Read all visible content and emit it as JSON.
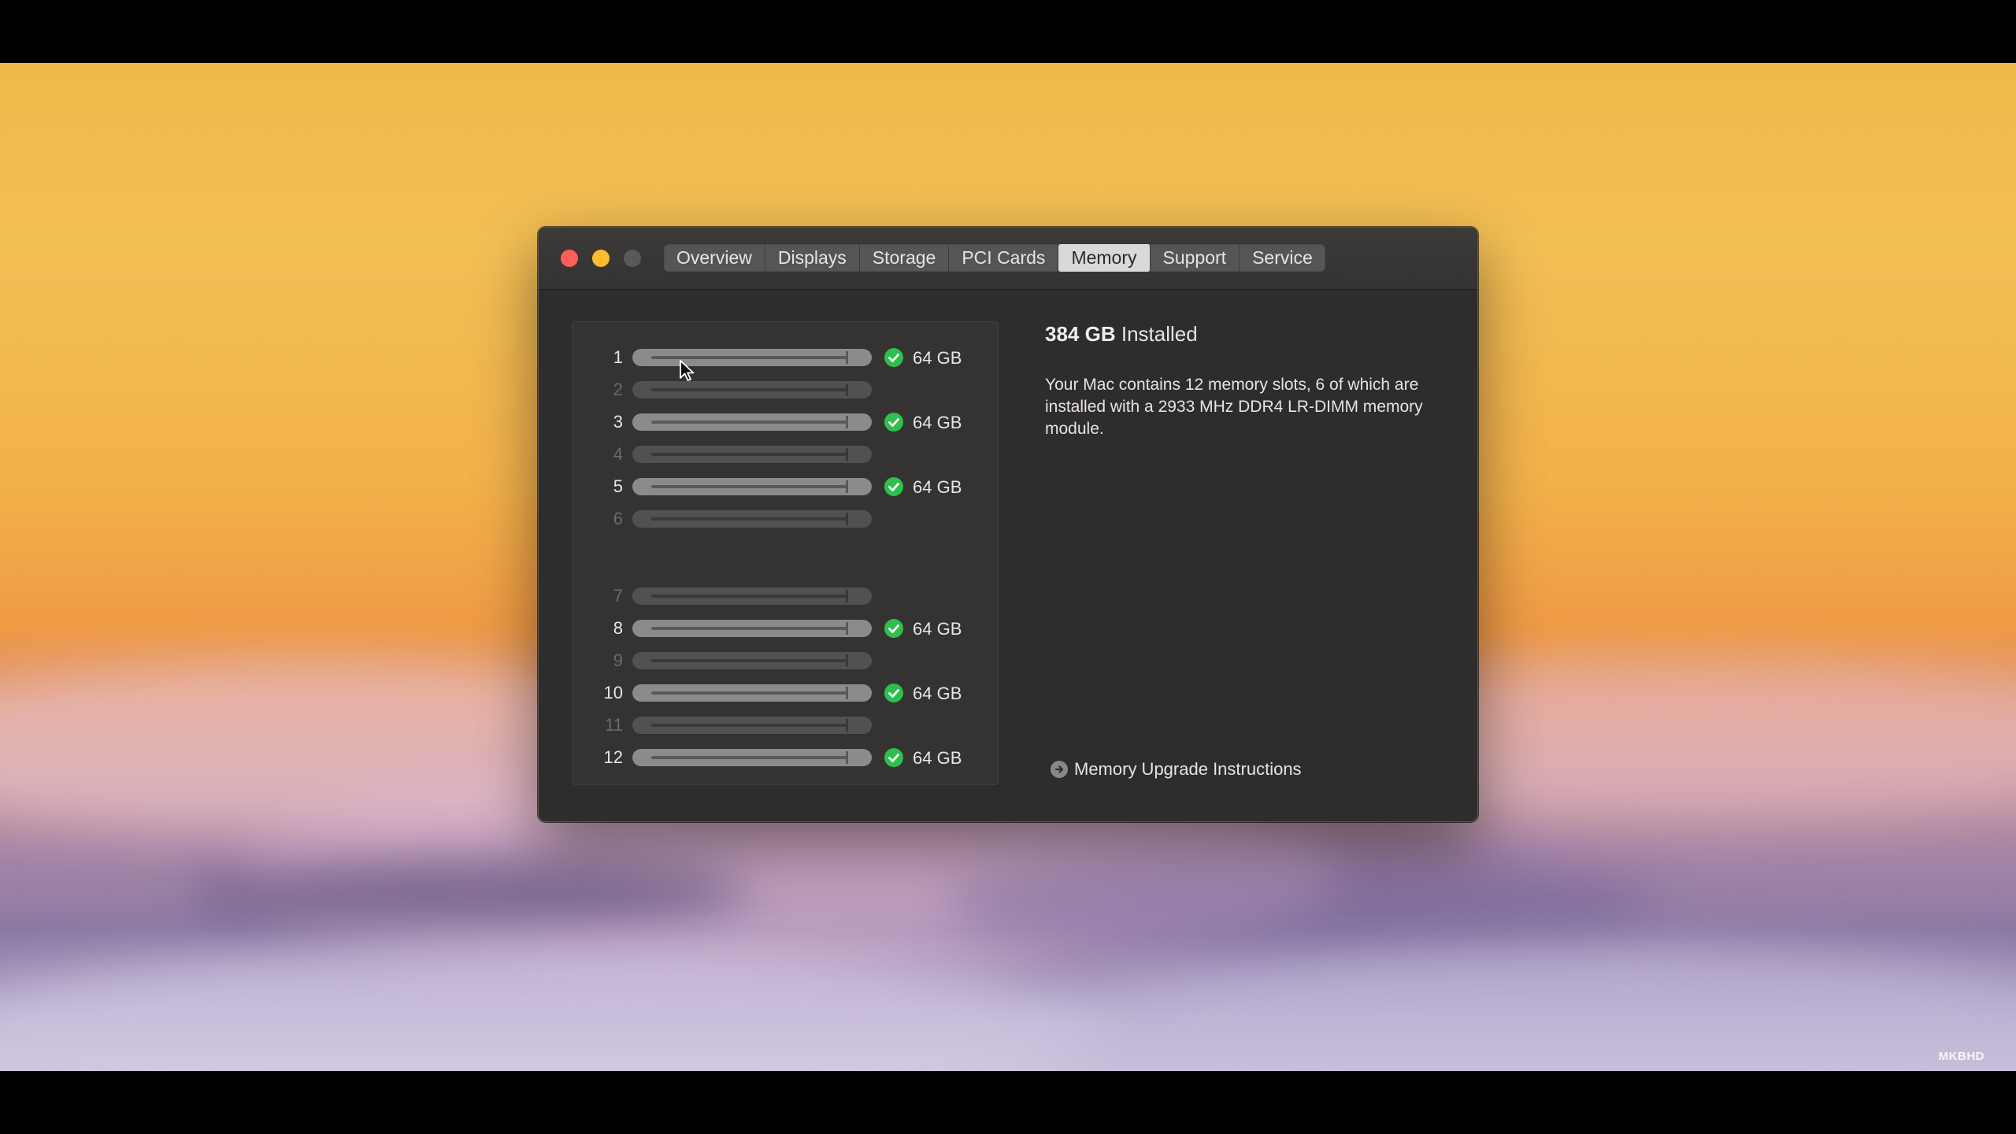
{
  "window": {
    "tabs": [
      {
        "label": "Overview"
      },
      {
        "label": "Displays"
      },
      {
        "label": "Storage"
      },
      {
        "label": "PCI Cards"
      },
      {
        "label": "Memory"
      },
      {
        "label": "Support"
      },
      {
        "label": "Service"
      }
    ],
    "active_tab": "Memory"
  },
  "memory": {
    "installed_amount": "384 GB",
    "installed_suffix": "Installed",
    "description": "Your Mac contains 12 memory slots, 6 of which are installed with a 2933 MHz DDR4 LR-DIMM memory module.",
    "upgrade_link": "Memory Upgrade Instructions",
    "slots": [
      {
        "number": "1",
        "installed": true,
        "size": "64 GB"
      },
      {
        "number": "2",
        "installed": false,
        "size": ""
      },
      {
        "number": "3",
        "installed": true,
        "size": "64 GB"
      },
      {
        "number": "4",
        "installed": false,
        "size": ""
      },
      {
        "number": "5",
        "installed": true,
        "size": "64 GB"
      },
      {
        "number": "6",
        "installed": false,
        "size": ""
      },
      {
        "number": "7",
        "installed": false,
        "size": ""
      },
      {
        "number": "8",
        "installed": true,
        "size": "64 GB"
      },
      {
        "number": "9",
        "installed": false,
        "size": ""
      },
      {
        "number": "10",
        "installed": true,
        "size": "64 GB"
      },
      {
        "number": "11",
        "installed": false,
        "size": ""
      },
      {
        "number": "12",
        "installed": true,
        "size": "64 GB"
      }
    ]
  },
  "watermark": "MKBHD",
  "colors": {
    "close": "#fe5f57",
    "minimize": "#febc2e",
    "check": "#2fbf4c"
  }
}
